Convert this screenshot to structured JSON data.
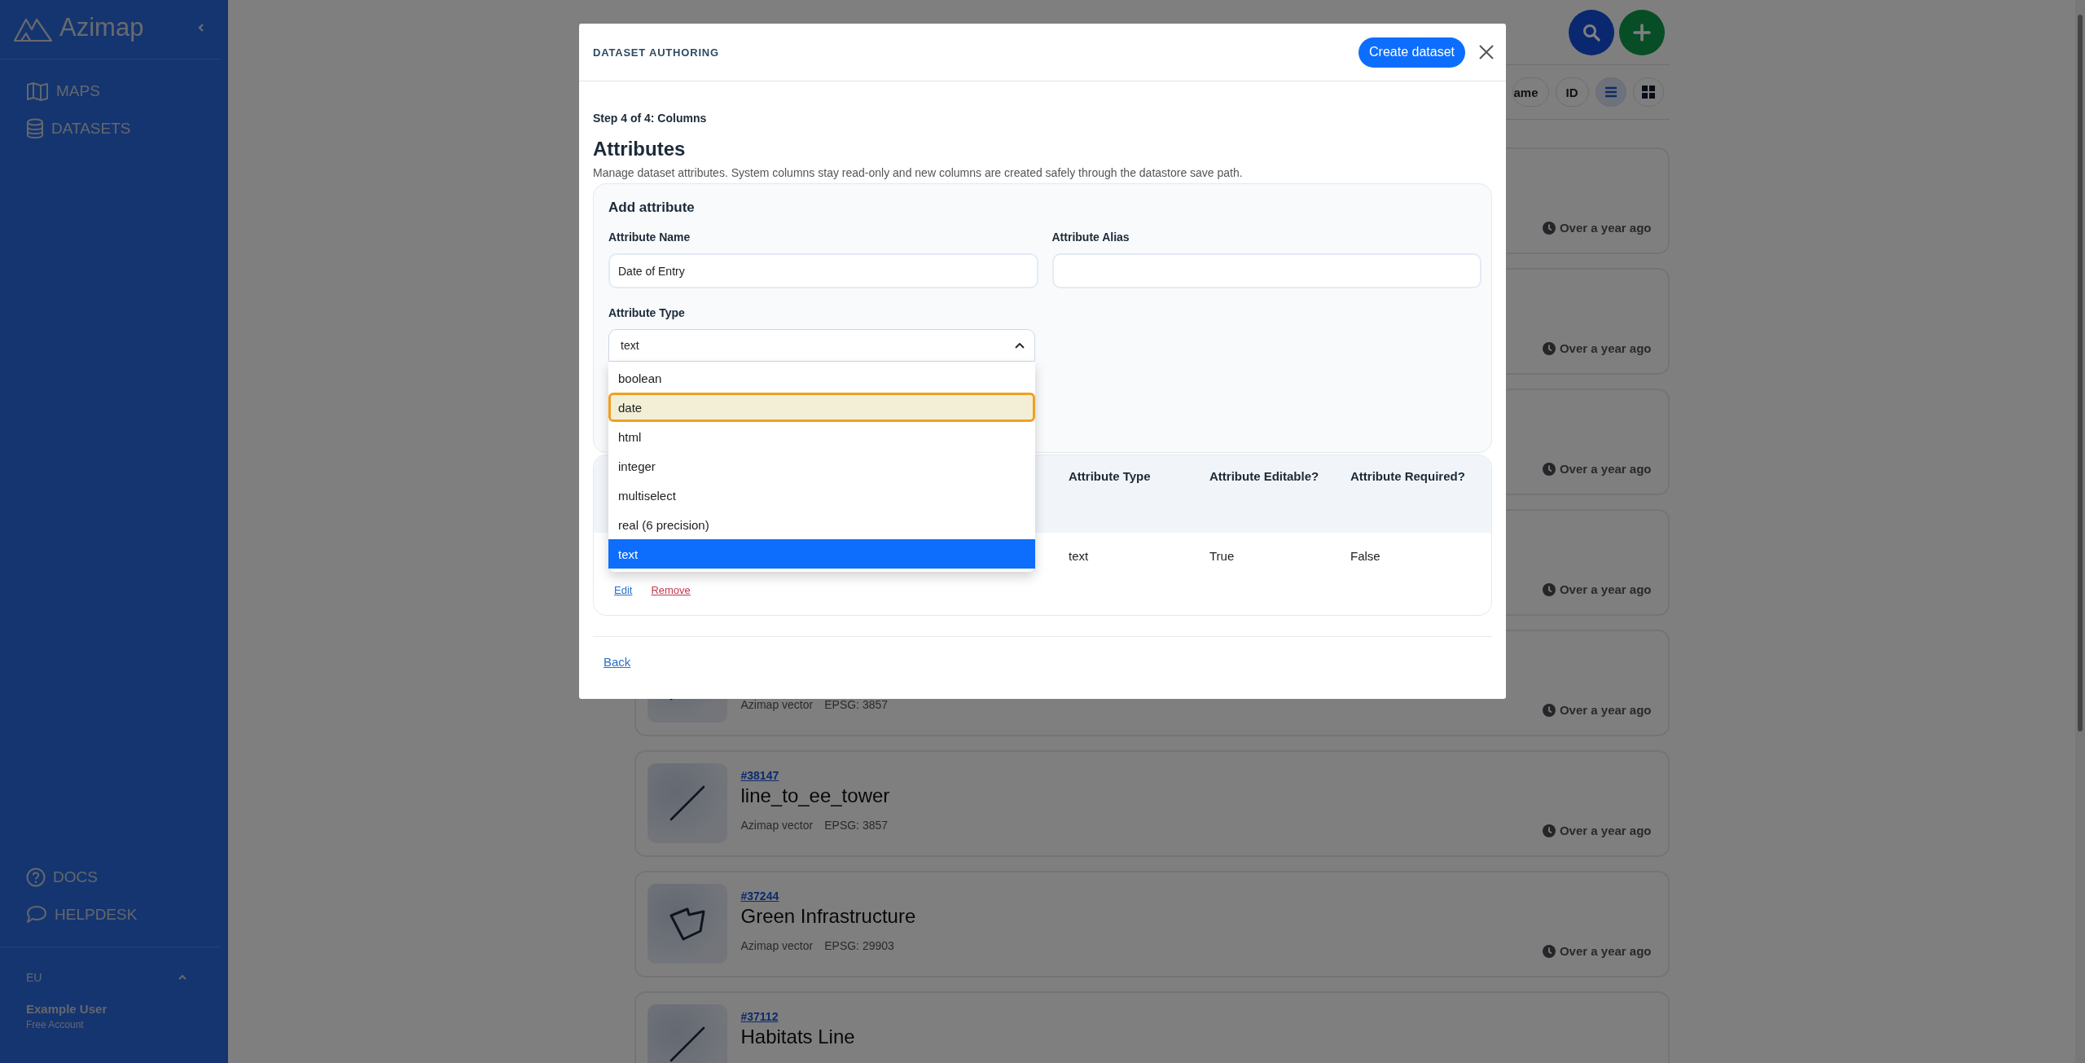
{
  "sidebar": {
    "brand": "Azimap",
    "nav": [
      {
        "label": "MAPS",
        "kind": "map"
      },
      {
        "label": "DATASETS",
        "kind": "database"
      }
    ],
    "footer_links": [
      {
        "label": "DOCS",
        "kind": "question"
      },
      {
        "label": "HELPDESK",
        "kind": "chat"
      }
    ],
    "region": "EU",
    "user": {
      "name": "Example User",
      "plan": "Free Account"
    }
  },
  "toolbar": {
    "sort_options": [
      {
        "label": "ame"
      },
      {
        "label": "ID"
      }
    ],
    "views": [
      {
        "kind": "list",
        "selected": true
      },
      {
        "kind": "grid",
        "selected": false
      }
    ]
  },
  "datasets": [
    {
      "time": "Over a year ago"
    },
    {
      "time": "Over a year ago"
    },
    {
      "time": "Over a year ago"
    },
    {
      "time": "Over a year ago"
    },
    {
      "kind": "line",
      "source": "Azimap vector",
      "epsg": "EPSG: 3857",
      "time": "Over a year ago"
    },
    {
      "kind": "line",
      "id": "#38147",
      "name": "line_to_ee_tower",
      "source": "Azimap vector",
      "epsg": "EPSG: 3857",
      "time": "Over a year ago"
    },
    {
      "kind": "polygon",
      "id": "#37244",
      "name": "Green Infrastructure",
      "source": "Azimap vector",
      "epsg": "EPSG: 29903",
      "time": "Over a year ago"
    },
    {
      "kind": "line",
      "id": "#37112",
      "name": "Habitats Line"
    }
  ],
  "modal": {
    "title": "DATASET AUTHORING",
    "primary_button": "Create dataset",
    "step": "Step 4 of 4: Columns",
    "heading": "Attributes",
    "description": "Manage dataset attributes. System columns stay read-only and new columns are created safely through the datastore save path.",
    "add_form": {
      "title": "Add attribute",
      "fields": [
        {
          "label": "Attribute Name",
          "value": "Date of Entry"
        },
        {
          "label": "Attribute Alias"
        }
      ],
      "type_field": {
        "label": "Attribute Type",
        "value": "text",
        "expanded": true,
        "options": [
          {
            "label": "boolean",
            "selected": false,
            "highlighted": false
          },
          {
            "label": "date",
            "selected": false,
            "highlighted": true
          },
          {
            "label": "html",
            "selected": false,
            "highlighted": false
          },
          {
            "label": "integer",
            "selected": false,
            "highlighted": false
          },
          {
            "label": "multiselect",
            "selected": false,
            "highlighted": false
          },
          {
            "label": "real (6 precision)",
            "selected": false,
            "highlighted": false
          },
          {
            "label": "text",
            "selected": true,
            "highlighted": false
          }
        ]
      }
    },
    "table": {
      "columns": [
        "Attribute Type",
        "Attribute Editable?",
        "Attribute Required?"
      ],
      "rows": [
        {
          "cells": [
            "text",
            "True",
            "False"
          ],
          "actions": [
            {
              "label": "Edit",
              "kind": "edit"
            },
            {
              "label": "Remove",
              "kind": "danger"
            }
          ]
        }
      ]
    },
    "back_link": "Back"
  }
}
